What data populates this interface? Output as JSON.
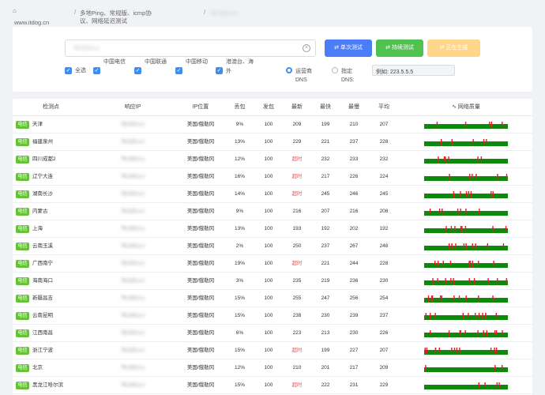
{
  "breadcrumb": {
    "home_icon": "home-icon",
    "site": "www.itdog.cn",
    "section": "多地Ping、常规版、icmp协议、网络延迟测试",
    "current": "76.223.x.x"
  },
  "search": {
    "value": "76.223.x.x"
  },
  "buttons": {
    "single": "单次测试",
    "continuous": "持续测试",
    "generating": "正在生成"
  },
  "filters": [
    {
      "label": "全选",
      "checked": true
    },
    {
      "label": "中国电信",
      "checked": true
    },
    {
      "label": "中国联通",
      "checked": true
    },
    {
      "label": "中国移动",
      "checked": true
    },
    {
      "label": "港澳台、海外",
      "checked": true
    }
  ],
  "dns": {
    "operator_label": "运营商DNS",
    "custom_label": "指定DNS:",
    "custom_value": "例如: 223.5.5.5"
  },
  "table": {
    "headers": [
      "检测点",
      "响应IP",
      "IP位置",
      "丢包",
      "发包",
      "最新",
      "最快",
      "最慢",
      "平均",
      "网络质量"
    ],
    "isp_badge": "电信",
    "rows": [
      {
        "location": "天津",
        "ip": "76.223.x.x",
        "ip_loc": "美国/俄勒冈",
        "loss": "9%",
        "sent": "100",
        "latest": "209",
        "fast": "199",
        "slow": "210",
        "avg": "207"
      },
      {
        "location": "福建泉州",
        "ip": "76.223.x.x",
        "ip_loc": "美国/俄勒冈",
        "loss": "13%",
        "sent": "100",
        "latest": "229",
        "fast": "221",
        "slow": "237",
        "avg": "228"
      },
      {
        "location": "四川成都2",
        "ip": "76.223.x.x",
        "ip_loc": "美国/俄勒冈",
        "loss": "12%",
        "sent": "100",
        "latest": "超时",
        "fast": "232",
        "slow": "233",
        "avg": "232"
      },
      {
        "location": "辽宁大连",
        "ip": "76.223.x.x",
        "ip_loc": "美国/俄勒冈",
        "loss": "16%",
        "sent": "100",
        "latest": "超时",
        "fast": "217",
        "slow": "226",
        "avg": "224"
      },
      {
        "location": "湖南长沙",
        "ip": "76.223.x.x",
        "ip_loc": "美国/俄勒冈",
        "loss": "14%",
        "sent": "100",
        "latest": "超时",
        "fast": "245",
        "slow": "246",
        "avg": "245"
      },
      {
        "location": "内蒙古",
        "ip": "76.223.x.x",
        "ip_loc": "美国/俄勒冈",
        "loss": "9%",
        "sent": "100",
        "latest": "216",
        "fast": "207",
        "slow": "216",
        "avg": "208"
      },
      {
        "location": "上海",
        "ip": "76.223.x.x",
        "ip_loc": "美国/俄勒冈",
        "loss": "13%",
        "sent": "100",
        "latest": "193",
        "fast": "192",
        "slow": "202",
        "avg": "192"
      },
      {
        "location": "云南玉溪",
        "ip": "76.223.x.x",
        "ip_loc": "美国/俄勒冈",
        "loss": "2%",
        "sent": "100",
        "latest": "250",
        "fast": "237",
        "slow": "267",
        "avg": "248"
      },
      {
        "location": "广西南宁",
        "ip": "76.223.x.x",
        "ip_loc": "美国/俄勒冈",
        "loss": "19%",
        "sent": "100",
        "latest": "超时",
        "fast": "221",
        "slow": "244",
        "avg": "228"
      },
      {
        "location": "海南海口",
        "ip": "76.223.x.x",
        "ip_loc": "美国/俄勒冈",
        "loss": "3%",
        "sent": "100",
        "latest": "235",
        "fast": "219",
        "slow": "236",
        "avg": "230"
      },
      {
        "location": "新疆昌吉",
        "ip": "76.223.x.x",
        "ip_loc": "美国/俄勒冈",
        "loss": "15%",
        "sent": "100",
        "latest": "255",
        "fast": "247",
        "slow": "256",
        "avg": "254"
      },
      {
        "location": "云南昆明",
        "ip": "76.223.x.x",
        "ip_loc": "美国/俄勒冈",
        "loss": "15%",
        "sent": "100",
        "latest": "238",
        "fast": "230",
        "slow": "239",
        "avg": "237"
      },
      {
        "location": "江西南昌",
        "ip": "76.223.x.x",
        "ip_loc": "美国/俄勒冈",
        "loss": "6%",
        "sent": "100",
        "latest": "223",
        "fast": "213",
        "slow": "230",
        "avg": "226"
      },
      {
        "location": "浙江宁波",
        "ip": "76.223.x.x",
        "ip_loc": "美国/俄勒冈",
        "loss": "15%",
        "sent": "100",
        "latest": "超时",
        "fast": "199",
        "slow": "227",
        "avg": "207"
      },
      {
        "location": "北京",
        "ip": "76.223.x.x",
        "ip_loc": "美国/俄勒冈",
        "loss": "12%",
        "sent": "100",
        "latest": "210",
        "fast": "201",
        "slow": "217",
        "avg": "209"
      },
      {
        "location": "黑龙江哈尔滨",
        "ip": "76.223.x.x",
        "ip_loc": "美国/俄勒冈",
        "loss": "15%",
        "sent": "100",
        "latest": "超时",
        "fast": "222",
        "slow": "231",
        "avg": "229"
      }
    ]
  },
  "colors": {
    "ok": "#0d8a0d",
    "loss": "#e01f1f",
    "badge": "#67c23a",
    "primary": "#4a7df7"
  }
}
